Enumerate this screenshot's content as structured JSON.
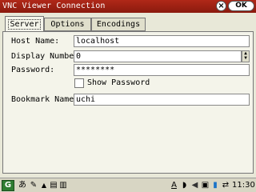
{
  "window": {
    "title": "VNC Viewer Connection",
    "close_label": "×",
    "ok_label": "OK"
  },
  "tabs": [
    {
      "label": "Server",
      "active": true
    },
    {
      "label": "Options",
      "active": false
    },
    {
      "label": "Encodings",
      "active": false
    }
  ],
  "form": {
    "host_label": "Host Name:",
    "host_value": "localhost",
    "display_label": "Display Number:",
    "display_value": "0",
    "password_label": "Password:",
    "password_value": "********",
    "show_password_label": "Show Password",
    "show_password_checked": false,
    "bookmark_label": "Bookmark Name:",
    "bookmark_value": "uchi"
  },
  "taskbar": {
    "start_label": "G",
    "input_mode": "あ",
    "pen_icon": "✎",
    "up_icon": "▲",
    "apps_icon": "▤",
    "keyboard_icon": "▥",
    "font_icon": "A",
    "wifi_icon": "◗",
    "sound_icon": "◀",
    "card_icon": "▣",
    "battery_icon": "▮",
    "network_icon": "⇄",
    "clock": "11:30"
  },
  "colors": {
    "titlebar": "#9e2214",
    "panel": "#f4f4ea",
    "background": "#e8e8d8"
  }
}
